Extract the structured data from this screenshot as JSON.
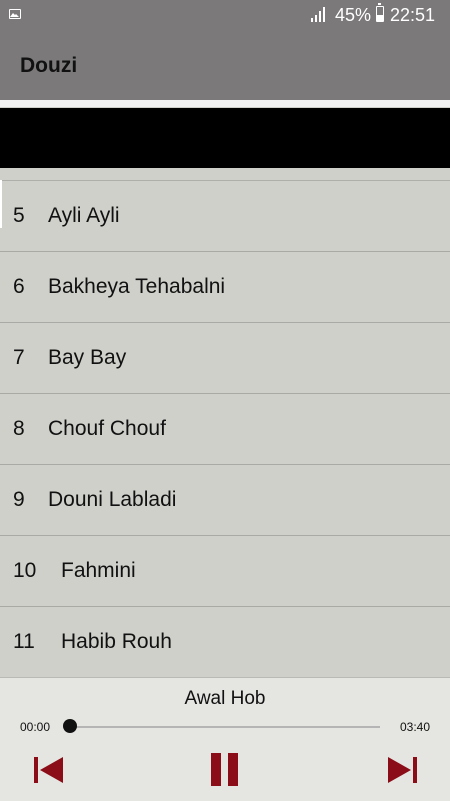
{
  "status_bar": {
    "battery": "45%",
    "time": "22:51",
    "icons": [
      "image-notification-icon",
      "signal-icon",
      "battery-icon"
    ]
  },
  "app_bar": {
    "title": "Douzi"
  },
  "songs": [
    {
      "number": "5",
      "title": "Ayli Ayli"
    },
    {
      "number": "6",
      "title": "Bakheya Tehabalni"
    },
    {
      "number": "7",
      "title": "Bay Bay"
    },
    {
      "number": "8",
      "title": "Chouf Chouf"
    },
    {
      "number": "9",
      "title": "Douni Labladi"
    },
    {
      "number": "10",
      "title": "Fahmini"
    },
    {
      "number": "11",
      "title": "Habib Rouh"
    }
  ],
  "player": {
    "now_playing": "Awal Hob",
    "elapsed": "00:00",
    "duration": "03:40",
    "progress": 0,
    "controls": [
      "previous-icon",
      "pause-icon",
      "next-icon"
    ]
  },
  "colors": {
    "bar": "#7c797a",
    "list_background": "#cfd0ca",
    "player_background": "#e5e6e2",
    "control_accent": "#8b0d17"
  }
}
